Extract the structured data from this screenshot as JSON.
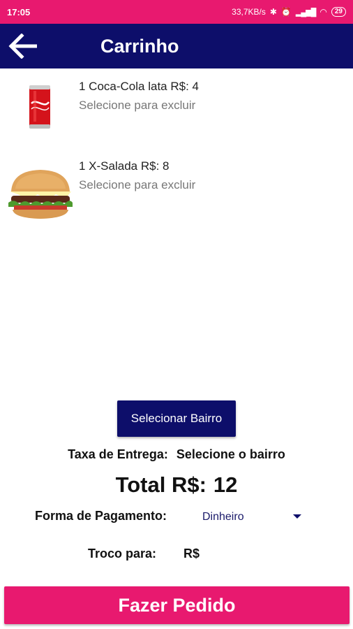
{
  "status_bar": {
    "time": "17:05",
    "net_speed": "33,7KB/s",
    "battery": "29"
  },
  "app_bar": {
    "title": "Carrinho"
  },
  "cart": {
    "items": [
      {
        "name": "1 Coca-Cola lata R$: 4",
        "hint": "Selecione para excluir",
        "icon": "coca-cola-can-icon"
      },
      {
        "name": "1 X-Salada R$: 8",
        "hint": "Selecione para excluir",
        "icon": "burger-icon"
      }
    ]
  },
  "delivery": {
    "select_button": "Selecionar Bairro",
    "fee_label": "Taxa de Entrega:",
    "fee_value": "Selecione o bairro"
  },
  "total": {
    "label": "Total R$:",
    "value": "12"
  },
  "payment": {
    "label": "Forma de Pagamento:",
    "selected": "Dinheiro"
  },
  "change": {
    "label": "Troco para:",
    "value": "R$"
  },
  "actions": {
    "order_button": "Fazer Pedido"
  },
  "colors": {
    "accent_pink": "#e8196f",
    "navy": "#0d0e6a"
  }
}
